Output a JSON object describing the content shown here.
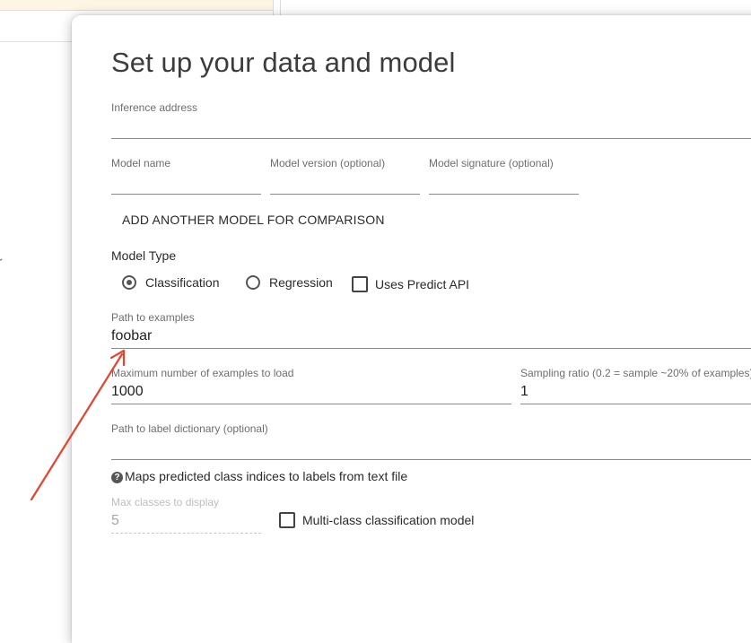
{
  "dialog": {
    "title": "Set up your data and model",
    "inference_address": {
      "label": "Inference address",
      "value": ""
    },
    "model_name": {
      "label": "Model name",
      "value": ""
    },
    "model_version": {
      "label": "Model version (optional)",
      "value": ""
    },
    "model_signature": {
      "label": "Model signature (optional)",
      "value": ""
    },
    "add_model_button": "ADD ANOTHER MODEL FOR COMPARISON",
    "model_type": {
      "heading": "Model Type",
      "options": [
        {
          "label": "Classification",
          "selected": true
        },
        {
          "label": "Regression",
          "selected": false
        }
      ],
      "predict_api": {
        "label": "Uses Predict API",
        "checked": false
      }
    },
    "path_to_examples": {
      "label": "Path to examples",
      "value": "foobar"
    },
    "max_examples": {
      "label": "Maximum number of examples to load",
      "value": "1000"
    },
    "sampling_ratio": {
      "label": "Sampling ratio (0.2 = sample ~20% of examples)",
      "value": "1"
    },
    "label_dictionary": {
      "label": "Path to label dictionary (optional)",
      "value": ""
    },
    "help_text": "Maps predicted class indices to labels from text file",
    "help_icon": "help-circle-icon",
    "max_classes": {
      "label": "Max classes to display",
      "value": "5",
      "disabled": true
    },
    "multi_class": {
      "label": "Multi-class classification model",
      "checked": false
    }
  },
  "annotation": {
    "arrow_color": "#e8412c"
  }
}
